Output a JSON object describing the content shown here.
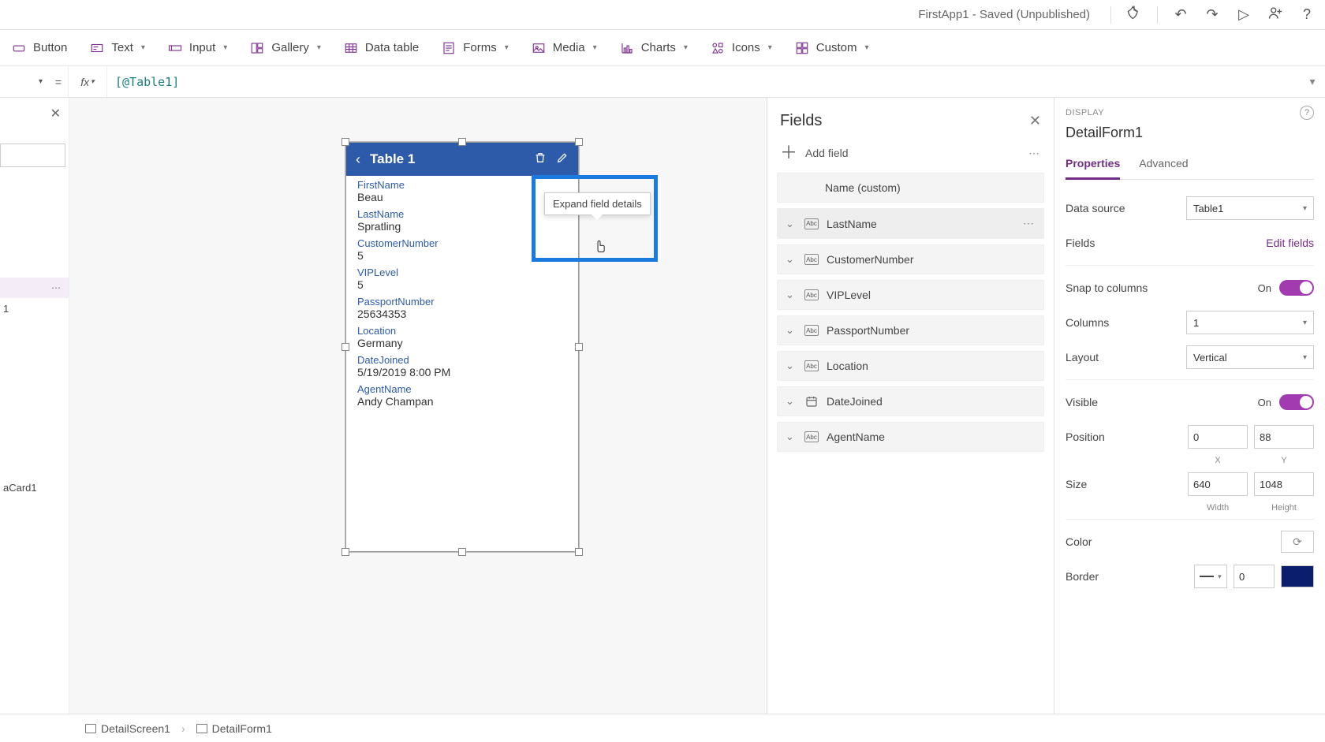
{
  "titlebar": {
    "title": "FirstApp1 - Saved (Unpublished)"
  },
  "ribbon": {
    "button": "Button",
    "text": "Text",
    "input": "Input",
    "gallery": "Gallery",
    "datatable": "Data table",
    "forms": "Forms",
    "media": "Media",
    "charts": "Charts",
    "icons": "Icons",
    "custom": "Custom"
  },
  "formula": {
    "equals": "=",
    "fx": "fx",
    "expression": "[@Table1]"
  },
  "left_tree": {
    "item_form": "1",
    "item_datacard": "aCard1"
  },
  "tooltip": {
    "expand_field": "Expand field details"
  },
  "phone": {
    "title": "Table 1",
    "fields": [
      {
        "label": "FirstName",
        "value": "Beau"
      },
      {
        "label": "LastName",
        "value": "Spratling"
      },
      {
        "label": "CustomerNumber",
        "value": "5"
      },
      {
        "label": "VIPLevel",
        "value": "5"
      },
      {
        "label": "PassportNumber",
        "value": "25634353"
      },
      {
        "label": "Location",
        "value": "Germany"
      },
      {
        "label": "DateJoined",
        "value": "5/19/2019 8:00 PM"
      },
      {
        "label": "AgentName",
        "value": "Andy Champan"
      }
    ]
  },
  "fieldspane": {
    "title": "Fields",
    "add": "Add field",
    "items": [
      {
        "name": "Name (custom)",
        "type": "abc"
      },
      {
        "name": "LastName",
        "type": "abc",
        "selected": true
      },
      {
        "name": "CustomerNumber",
        "type": "abc"
      },
      {
        "name": "VIPLevel",
        "type": "abc"
      },
      {
        "name": "PassportNumber",
        "type": "abc"
      },
      {
        "name": "Location",
        "type": "abc"
      },
      {
        "name": "DateJoined",
        "type": "date"
      },
      {
        "name": "AgentName",
        "type": "abc"
      }
    ]
  },
  "props": {
    "section": "DISPLAY",
    "name": "DetailForm1",
    "tabs": {
      "properties": "Properties",
      "advanced": "Advanced"
    },
    "data_source": {
      "label": "Data source",
      "value": "Table1"
    },
    "fields": {
      "label": "Fields",
      "link": "Edit fields"
    },
    "snap": {
      "label": "Snap to columns",
      "value": "On"
    },
    "columns": {
      "label": "Columns",
      "value": "1"
    },
    "layout": {
      "label": "Layout",
      "value": "Vertical"
    },
    "visible": {
      "label": "Visible",
      "value": "On"
    },
    "position": {
      "label": "Position",
      "x": "0",
      "y": "88",
      "xl": "X",
      "yl": "Y"
    },
    "size": {
      "label": "Size",
      "w": "640",
      "h": "1048",
      "wl": "Width",
      "hl": "Height"
    },
    "color": {
      "label": "Color"
    },
    "border": {
      "label": "Border",
      "width": "0"
    }
  },
  "crumbs": {
    "screen": "DetailScreen1",
    "form": "DetailForm1"
  }
}
